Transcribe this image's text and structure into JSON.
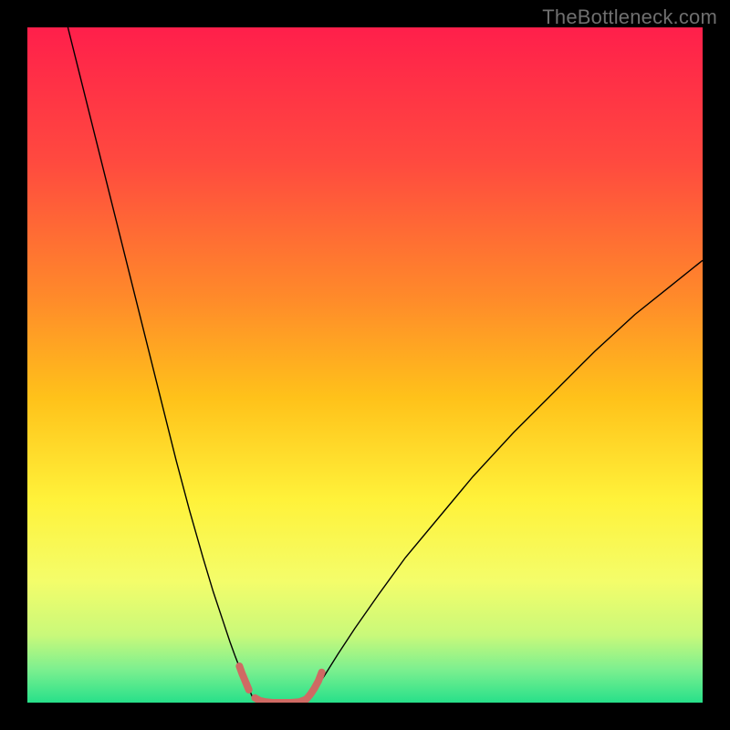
{
  "watermark": "TheBottleneck.com",
  "chart_data": {
    "type": "line",
    "title": "",
    "xlabel": "",
    "ylabel": "",
    "xlim": [
      0,
      100
    ],
    "ylim": [
      0,
      100
    ],
    "background_gradient_stops": [
      {
        "pos": 0.0,
        "color": "#ff1f4b"
      },
      {
        "pos": 0.2,
        "color": "#ff4a3f"
      },
      {
        "pos": 0.4,
        "color": "#ff8a2a"
      },
      {
        "pos": 0.55,
        "color": "#ffc21a"
      },
      {
        "pos": 0.7,
        "color": "#fff23a"
      },
      {
        "pos": 0.82,
        "color": "#f4fd6a"
      },
      {
        "pos": 0.9,
        "color": "#c9f97a"
      },
      {
        "pos": 0.95,
        "color": "#7ef08f"
      },
      {
        "pos": 1.0,
        "color": "#27e08a"
      }
    ],
    "series": [
      {
        "name": "left-curve",
        "color": "#000000",
        "width": 1.4,
        "x": [
          6.0,
          8.0,
          10.0,
          12.5,
          15.0,
          17.5,
          20.0,
          22.0,
          24.0,
          26.0,
          27.5,
          29.0,
          30.0,
          30.8,
          31.5,
          32.0,
          32.5,
          33.0,
          33.5
        ],
        "y": [
          100.0,
          92.0,
          84.0,
          74.0,
          64.0,
          54.0,
          44.0,
          36.0,
          28.5,
          21.5,
          16.5,
          12.0,
          9.0,
          6.8,
          5.0,
          3.8,
          2.8,
          1.6,
          0.4
        ]
      },
      {
        "name": "right-curve",
        "color": "#000000",
        "width": 1.4,
        "x": [
          41.5,
          42.5,
          44.0,
          46.0,
          48.5,
          52.0,
          56.0,
          61.0,
          66.0,
          72.0,
          78.0,
          84.0,
          90.0,
          95.0,
          100.0
        ],
        "y": [
          0.4,
          1.8,
          4.0,
          7.2,
          11.0,
          16.0,
          21.5,
          27.5,
          33.5,
          40.0,
          46.0,
          52.0,
          57.5,
          61.5,
          65.5
        ]
      },
      {
        "name": "highlight-segments",
        "color": "#cf6a63",
        "width": 8.0,
        "linecap": "round",
        "segments": [
          {
            "x": [
              31.4,
              31.8,
              32.3,
              32.8
            ],
            "y": [
              5.4,
              4.3,
              3.1,
              1.9
            ]
          },
          {
            "x": [
              33.7,
              34.4,
              35.3,
              36.3,
              37.5,
              39.0,
              40.3,
              41.3,
              41.9,
              42.5,
              43.1,
              43.6
            ],
            "y": [
              0.7,
              0.3,
              0.1,
              0.0,
              0.0,
              0.0,
              0.1,
              0.5,
              1.2,
              2.1,
              3.2,
              4.5
            ]
          }
        ]
      }
    ]
  }
}
